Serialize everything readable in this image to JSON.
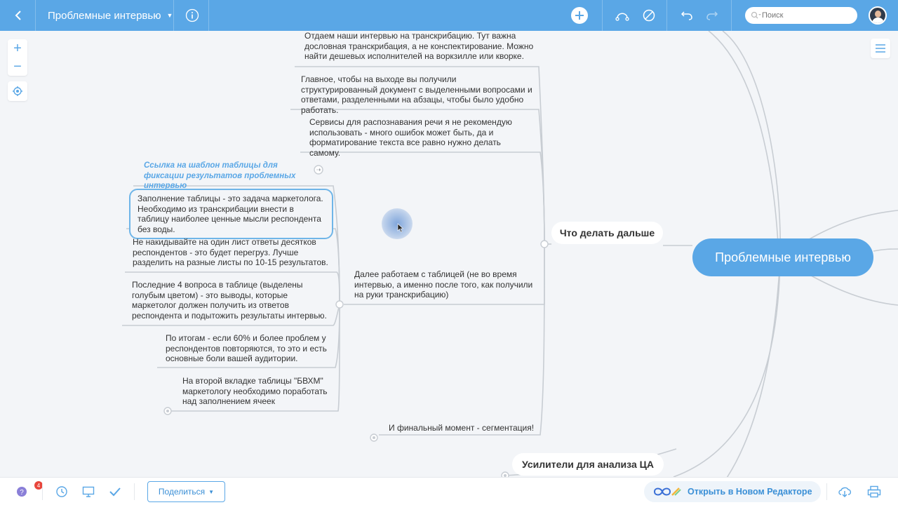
{
  "header": {
    "back_icon": "chevron-left-icon",
    "title": "Проблемные интервью",
    "search_placeholder": "Поиск"
  },
  "colors": {
    "accent": "#5aa7e6",
    "background": "#f3f5f8",
    "link": "#5aa7e6",
    "badge": "#e8463c"
  },
  "mindmap": {
    "root": "Проблемные интервью",
    "topics": {
      "next_steps": "Что делать дальше",
      "amplifiers": "Усилители для анализа ЦА"
    },
    "nodes": {
      "transcription": "Отдаем наши интервью на транскрибацию. Тут важна дословная транскрибация, а не конспектирование. Можно найти дешевых исполнителей на воркзилле или кворке.",
      "structured_doc": "Главное, чтобы на выходе вы получили структурированный документ с выделенными вопросами и ответами, разделенными на абзацы, чтобы было удобно работать.",
      "speech_services": "Сервисы для распознавания речи я не рекомендую использовать - много ошибок может быть, да и форматирование текста все равно нужно делать самому.",
      "table_link": "Ссылка на шаблон таблицы для фиксации результатов проблемных интервью",
      "fill_table": "Заполнение таблицы - это задача маркетолога. Необходимо из транскрибации внести в таблицу наиболее ценные мысли респондента без воды.",
      "one_sheet": "Не накидывайте на один лист ответы десятков респондентов - это будет перегруз. Лучше разделить на разные листы по 10-15 результатов.",
      "last_four": "Последние 4 вопроса в таблице (выделены голубым цветом) - это выводы, которые маркетолог должен получить из ответов респондента и подытожить результаты интервью.",
      "sixty_percent": "По итогам - если 60% и более проблем у респондентов повторяются, то это и есть основные боли вашей аудитории.",
      "bvhm_tab": "На второй вкладке таблицы \"БВХМ\" маркетологу необходимо поработать над заполнением ячеек",
      "work_with_table": "Далее работаем с таблицей (не во время интервью, а именно после того, как получили на руки транскрибацию)",
      "segmentation": "И финальный момент - сегментация!"
    }
  },
  "footer": {
    "notifications_count": "4",
    "share_label": "Поделиться",
    "open_new_editor": "Открыть в Новом Редакторе"
  }
}
